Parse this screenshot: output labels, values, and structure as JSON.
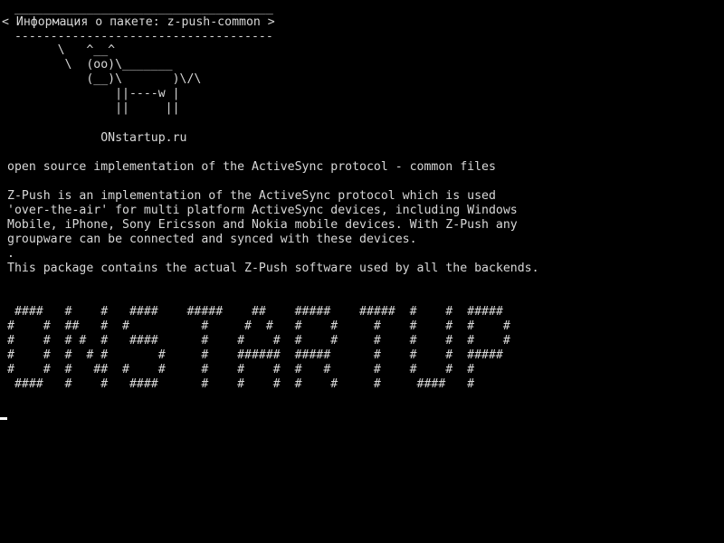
{
  "terminal": {
    "bubble_top": " ____________________________________",
    "bubble_title": "< Информация о пакете: z-push-common >",
    "bubble_bottom": " ------------------------------------",
    "cow": [
      "       \\   ^__^",
      "        \\  (oo)\\_______",
      "           (__)\\       )\\/\\",
      "               ||----w |",
      "               ||     ||"
    ],
    "site": "             ONstartup.ru",
    "summary": "open source implementation of the ActiveSync protocol - common files",
    "description": [
      "Z-Push is an implementation of the ActiveSync protocol which is used",
      "'over-the-air' for multi platform ActiveSync devices, including Windows",
      "Mobile, iPhone, Sony Ericsson and Nokia mobile devices. With Z-Push any",
      "groupware can be connected and synced with these devices."
    ],
    "dot": ".",
    "package_note": "This package contains the actual Z-Push software used by all the backends.",
    "banner": [
      " ####   #    #   ####    #####    ##    #####    #####  #    #  #####",
      "#    #  ##   #  #          #     #  #   #    #     #    #    #  #    #",
      "#    #  # #  #   ####      #    #    #  #    #     #    #    #  #    #",
      "#    #  #  # #       #     #    ######  #####      #    #    #  #####",
      "#    #  #   ##  #    #     #    #    #  #   #      #    #    #  #",
      " ####   #    #   ####      #    #    #  #    #     #     ####   #"
    ]
  }
}
